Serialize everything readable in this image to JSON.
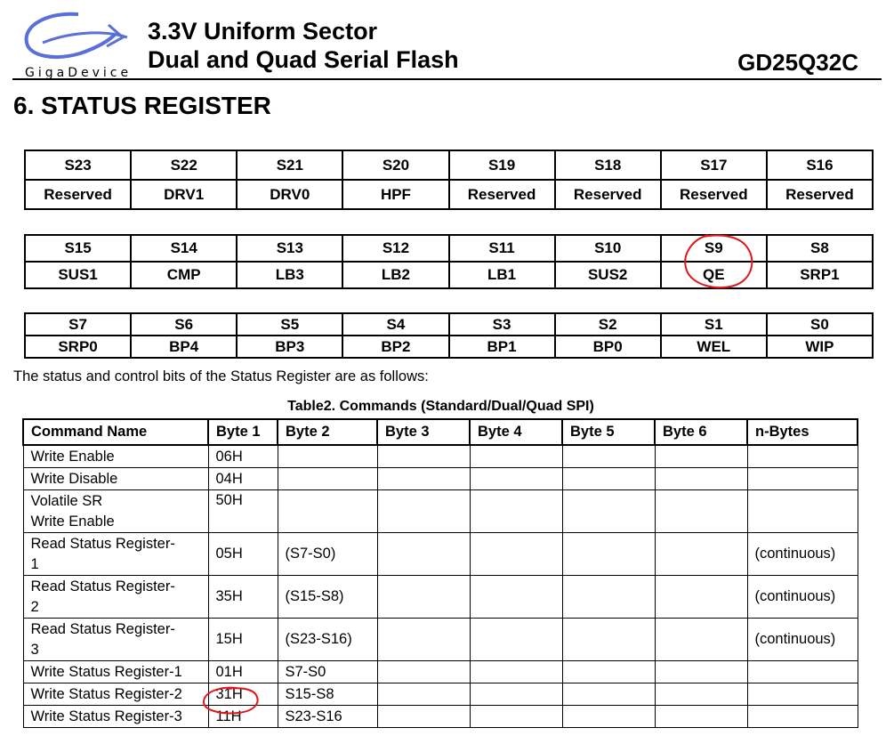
{
  "header": {
    "logo_text": "GigaDevice",
    "line1": "3.3V Uniform Sector",
    "line2": "Dual and Quad Serial Flash",
    "part_number": "GD25Q32C"
  },
  "section_title": "6.   STATUS REGISTER",
  "register_tables": [
    {
      "bits": [
        "S23",
        "S22",
        "S21",
        "S20",
        "S19",
        "S18",
        "S17",
        "S16"
      ],
      "names": [
        "Reserved",
        "DRV1",
        "DRV0",
        "HPF",
        "Reserved",
        "Reserved",
        "Reserved",
        "Reserved"
      ]
    },
    {
      "bits": [
        "S15",
        "S14",
        "S13",
        "S12",
        "S11",
        "S10",
        "S9",
        "S8"
      ],
      "names": [
        "SUS1",
        "CMP",
        "LB3",
        "LB2",
        "LB1",
        "SUS2",
        "QE",
        "SRP1"
      ]
    },
    {
      "bits": [
        "S7",
        "S6",
        "S5",
        "S4",
        "S3",
        "S2",
        "S1",
        "S0"
      ],
      "names": [
        "SRP0",
        "BP4",
        "BP3",
        "BP2",
        "BP1",
        "BP0",
        "WEL",
        "WIP"
      ]
    }
  ],
  "intro_text": "The status and control bits of the Status Register are as follows:",
  "commands_table": {
    "caption": "Table2. Commands (Standard/Dual/Quad SPI)",
    "headers": [
      "Command Name",
      "Byte 1",
      "Byte 2",
      "Byte 3",
      "Byte 4",
      "Byte 5",
      "Byte 6",
      "n-Bytes"
    ],
    "rows": [
      {
        "name": [
          "Write Enable"
        ],
        "byte1": "06H",
        "byte2": "",
        "nbytes": ""
      },
      {
        "name": [
          "Write Disable"
        ],
        "byte1": "04H",
        "byte2": "",
        "nbytes": ""
      },
      {
        "name": [
          "Volatile SR",
          "Write Enable"
        ],
        "byte1": "50H",
        "byte2": "",
        "nbytes": ""
      },
      {
        "name": [
          "Read Status Register-",
          "1"
        ],
        "byte1": "05H",
        "byte2": "(S7-S0)",
        "nbytes": "(continuous)"
      },
      {
        "name": [
          "Read Status Register-",
          "2"
        ],
        "byte1": "35H",
        "byte2": "(S15-S8)",
        "nbytes": "(continuous)"
      },
      {
        "name": [
          "Read Status Register-",
          "3"
        ],
        "byte1": "15H",
        "byte2": "(S23-S16)",
        "nbytes": "(continuous)"
      },
      {
        "name": [
          "Write Status Register-1"
        ],
        "byte1": "01H",
        "byte2": "S7-S0",
        "nbytes": ""
      },
      {
        "name": [
          "Write Status Register-2"
        ],
        "byte1": "31H",
        "byte2": "S15-S8",
        "nbytes": ""
      },
      {
        "name": [
          "Write Status Register-3"
        ],
        "byte1": "11H",
        "byte2": "S23-S16",
        "nbytes": ""
      }
    ]
  },
  "colors": {
    "logo_blue": "#5a6fd8",
    "annotation_red": "#e0161b"
  }
}
